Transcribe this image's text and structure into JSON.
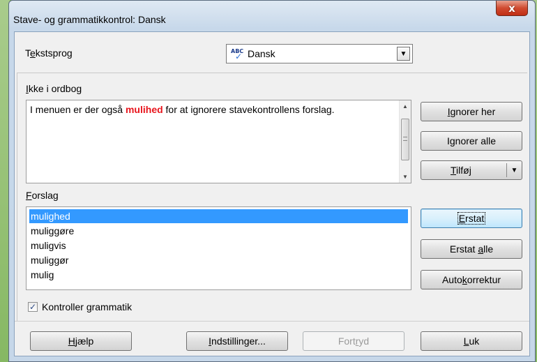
{
  "window": {
    "title": "Stave- og grammatikkontrol: Dansk",
    "close_glyph": "x"
  },
  "language": {
    "label_pre": "T",
    "label_underline": "e",
    "label_post": "kstsprog",
    "icon_text": "ABC",
    "icon_check": "✓",
    "value": "Dansk",
    "dropdown_glyph": "▼"
  },
  "not_in_dictionary": {
    "label_underline": "I",
    "label_post": "kke i ordbog",
    "text_before": "I menuen er der også ",
    "error_word": "mulihed",
    "text_after": " for at ignorere stavekontrollens forslag."
  },
  "side_buttons": {
    "ignore_once": {
      "pre": "",
      "u": "I",
      "post": "gnorer her"
    },
    "ignore_all": {
      "pre": "I",
      "u": "g",
      "post": "norer alle"
    },
    "add": {
      "pre": "",
      "u": "T",
      "post": "ilføj",
      "arrow": "▼"
    },
    "replace": {
      "pre": "",
      "u": "E",
      "post": "rstat"
    },
    "replace_all": {
      "pre": "Erstat ",
      "u": "a",
      "post": "lle"
    },
    "autocorrect": {
      "pre": "Auto",
      "u": "k",
      "post": "orrektur"
    }
  },
  "suggestions": {
    "label_underline": "F",
    "label_post": "orslag",
    "items": [
      "mulighed",
      "muliggøre",
      "muligvis",
      "muliggør",
      "mulig"
    ],
    "selected_index": 0
  },
  "grammar_check": {
    "label_pre": "Kontroller ",
    "label_underline": "g",
    "label_post": "rammatik",
    "checked": true,
    "check_glyph": "✓"
  },
  "footer": {
    "help": {
      "pre": "",
      "u": "H",
      "post": "jælp"
    },
    "options": {
      "pre": "",
      "u": "I",
      "post": "ndstillinger..."
    },
    "undo": {
      "pre": "Fort",
      "u": "r",
      "post": "yd"
    },
    "close": {
      "pre": "",
      "u": "L",
      "post": "uk"
    }
  }
}
